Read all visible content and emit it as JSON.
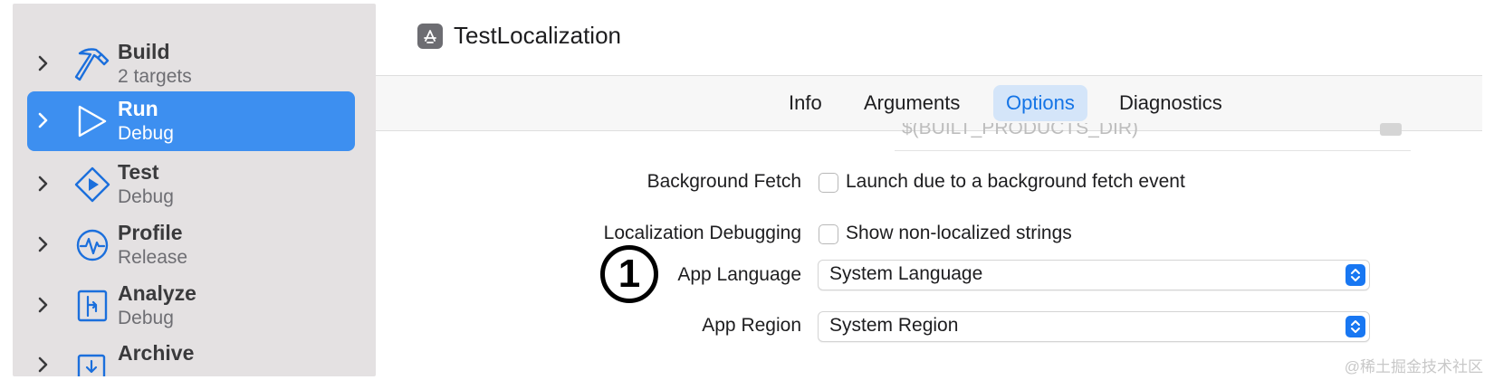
{
  "sidebar": {
    "items": [
      {
        "title": "Build",
        "subtitle": "2 targets",
        "icon": "hammer-icon"
      },
      {
        "title": "Run",
        "subtitle": "Debug",
        "icon": "play-icon",
        "selected": true
      },
      {
        "title": "Test",
        "subtitle": "Debug",
        "icon": "test-diamond-icon"
      },
      {
        "title": "Profile",
        "subtitle": "Release",
        "icon": "waveform-icon"
      },
      {
        "title": "Analyze",
        "subtitle": "Debug",
        "icon": "analyze-icon"
      },
      {
        "title": "Archive",
        "subtitle": "",
        "icon": "archive-icon"
      }
    ]
  },
  "header": {
    "title": "TestLocalization",
    "icon": "app-target-icon"
  },
  "tabs": [
    {
      "label": "Info"
    },
    {
      "label": "Arguments"
    },
    {
      "label": "Options",
      "active": true
    },
    {
      "label": "Diagnostics"
    }
  ],
  "options": {
    "working_dir_placeholder": "$(BUILT_PRODUCTS_DIR)",
    "background_fetch": {
      "label": "Background Fetch",
      "checkbox_label": "Launch due to a background fetch event",
      "checked": false
    },
    "localization_debugging": {
      "label": "Localization Debugging",
      "checkbox_label": "Show non-localized strings",
      "checked": false
    },
    "app_language": {
      "label": "App Language",
      "value": "System Language"
    },
    "app_region": {
      "label": "App Region",
      "value": "System Region"
    }
  },
  "annotation": {
    "marker": "1"
  },
  "watermark": "@稀土掘金技术社区",
  "colors": {
    "accent": "#1877f2",
    "selection": "#3d8ff0",
    "sidebar_bg": "#e4e1e2",
    "active_tab_bg": "#d4e5f9"
  }
}
